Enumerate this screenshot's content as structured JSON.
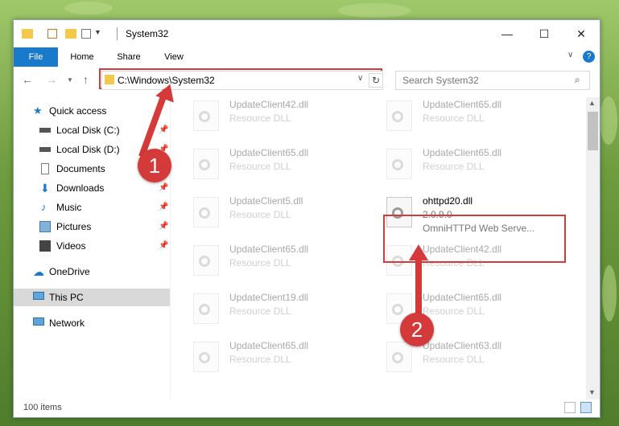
{
  "window": {
    "title": "System32"
  },
  "ribbon": {
    "tabs": [
      "File",
      "Home",
      "Share",
      "View"
    ]
  },
  "address": {
    "path": "C:\\Windows\\System32"
  },
  "search": {
    "placeholder": "Search System32"
  },
  "sidebar": {
    "items": [
      {
        "label": "Quick access",
        "pinned": false
      },
      {
        "label": "Local Disk (C:)",
        "pinned": true
      },
      {
        "label": "Local Disk (D:)",
        "pinned": true
      },
      {
        "label": "Documents",
        "pinned": true
      },
      {
        "label": "Downloads",
        "pinned": true
      },
      {
        "label": "Music",
        "pinned": true
      },
      {
        "label": "Pictures",
        "pinned": true
      },
      {
        "label": "Videos",
        "pinned": true
      },
      {
        "label": "OneDrive",
        "pinned": false
      },
      {
        "label": "This PC",
        "pinned": false,
        "selected": true
      },
      {
        "label": "Network",
        "pinned": false
      }
    ]
  },
  "files": {
    "left": [
      {
        "name": "UpdateClient42.dll",
        "desc": "Resource DLL"
      },
      {
        "name": "UpdateClient65.dll",
        "desc": "Resource DLL"
      },
      {
        "name": "UpdateClient5.dll",
        "desc": "Resource DLL"
      },
      {
        "name": "UpdateClient65.dll",
        "desc": "Resource DLL"
      },
      {
        "name": "UpdateClient19.dll",
        "desc": "Resource DLL"
      },
      {
        "name": "UpdateClient65.dll",
        "desc": "Resource DLL"
      }
    ],
    "right": [
      {
        "name": "UpdateClient65.dll",
        "desc": "Resource DLL"
      },
      {
        "name": "UpdateClient65.dll",
        "desc": "Resource DLL"
      },
      {
        "name": "ohttpd20.dll",
        "desc": "2.0.9.0",
        "desc2": "OmniHTTPd Web Serve..."
      },
      {
        "name": "UpdateClient42.dll",
        "desc": "Resource DLL"
      },
      {
        "name": "UpdateClient65.dll",
        "desc": "Resource DLL"
      },
      {
        "name": "UpdateClient63.dll",
        "desc": "Resource DLL"
      }
    ]
  },
  "status": {
    "count": "100 items"
  },
  "annotations": {
    "badge1": "1",
    "badge2": "2"
  },
  "colors": {
    "accent": "#1979ca",
    "highlight": "#d63b3b"
  }
}
